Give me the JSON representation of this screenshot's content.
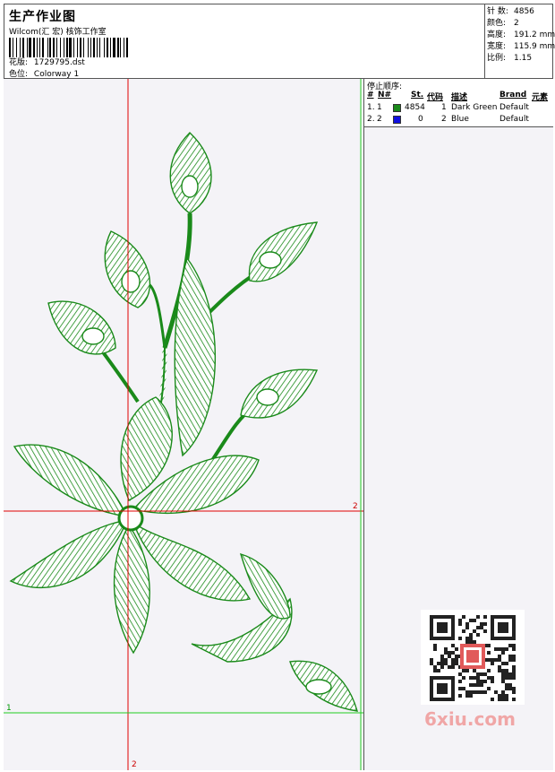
{
  "header": {
    "title": "生产作业图",
    "company": "Wilcom(汇 宏) 核饰工作室",
    "design_label": "花版:",
    "design_value": "1729795.dst",
    "colorway_label": "色位:",
    "colorway_value": "Colorway 1"
  },
  "stats": [
    {
      "label": "针 数:",
      "value": "4856"
    },
    {
      "label": "颜色:",
      "value": "2"
    },
    {
      "label": "高度:",
      "value": "191.2 mm"
    },
    {
      "label": "宽度:",
      "value": "115.9 mm"
    },
    {
      "label": "比例:",
      "value": "1.15"
    }
  ],
  "stop_sequence": {
    "title": "停止顺序:",
    "columns": [
      "#",
      "N#",
      "St.",
      "代码",
      "描述",
      "Brand",
      "元素"
    ],
    "rows": [
      {
        "idx": "1.",
        "n": "1",
        "color": "#1a8a1a",
        "st": "4854",
        "code": "1",
        "desc": "Dark Green",
        "brand": "Default"
      },
      {
        "idx": "2.",
        "n": "2",
        "color": "#1010e0",
        "st": "0",
        "code": "2",
        "desc": "Blue",
        "brand": "Default"
      }
    ]
  },
  "guides": {
    "red_h_label": "2",
    "red_v_label": "2",
    "green_h_label": "1"
  },
  "watermark": "6xiu.com",
  "colors": {
    "thread": "#1a8a1a",
    "guide_red": "#e00000",
    "guide_green": "#22cc22"
  }
}
